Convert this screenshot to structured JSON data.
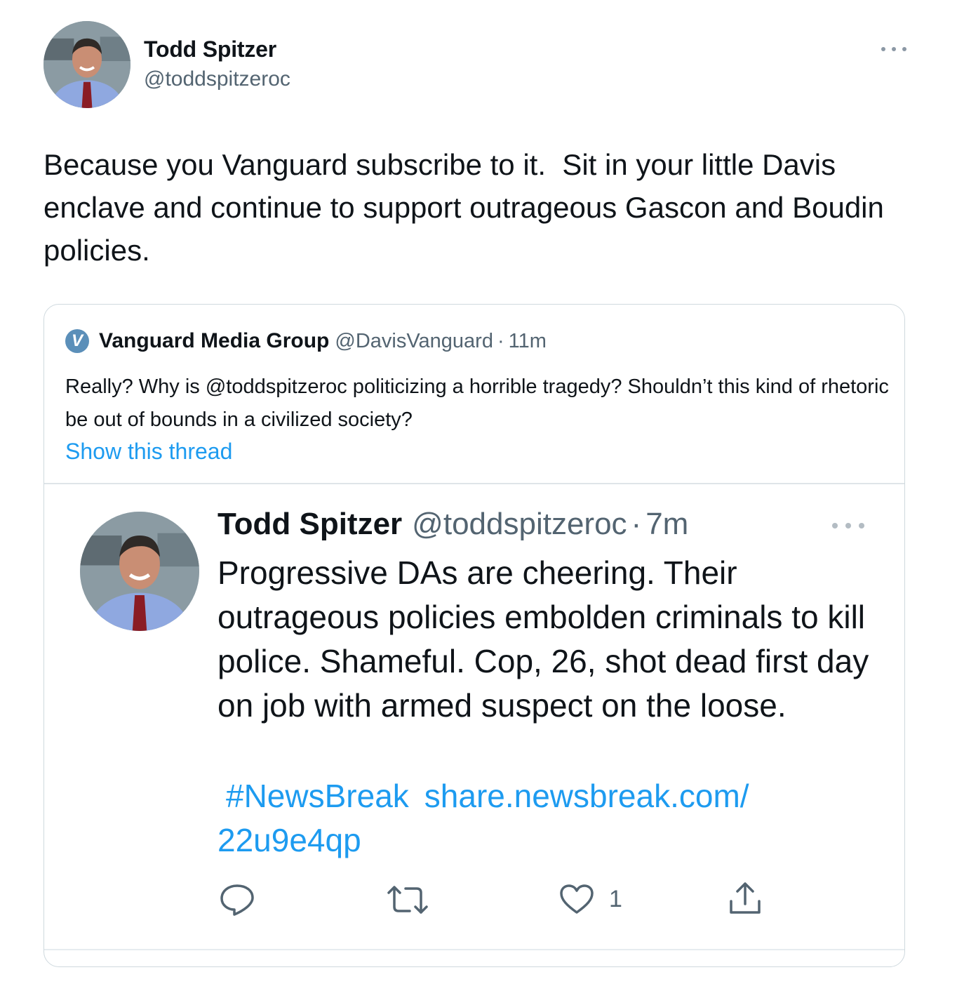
{
  "main_tweet": {
    "author_name": "Todd Spitzer",
    "author_handle": "@toddspitzeroc",
    "text": "Because you Vanguard subscribe to it.  Sit in your little Davis enclave and continue to support outrageous Gascon and Boudin policies."
  },
  "quoted_tweet": {
    "logo_letter": "V",
    "author_name": "Vanguard Media Group",
    "author_handle": "@DavisVanguard",
    "separator": "·",
    "time": "11m",
    "text": "Really?  Why is @toddspitzeroc politicizing a horrible tragedy?  Shouldn’t this kind of rhetoric be out of bounds in a civilized society?",
    "show_thread_label": "Show this thread"
  },
  "embedded_tweet": {
    "author_name": "Todd Spitzer",
    "author_handle": "@toddspitzeroc",
    "separator": "·",
    "time": "7m",
    "text": "Progressive DAs are cheering. Their outrageous policies embolden criminals to kill police. Shameful. Cop, 26, shot dead first day on job with armed suspect on the loose.",
    "hashtag": "#NewsBreak",
    "link_line1": "share.newsbreak.com/",
    "link_line2": "22u9e4qp",
    "like_count": "1",
    "icons": [
      "reply-icon",
      "retweet-icon",
      "like-icon",
      "share-icon",
      "more-icon"
    ]
  },
  "colors": {
    "link": "#1d9bf0",
    "secondary_text": "#536471",
    "border": "#cfd9de",
    "vanguard_badge": "#5b8fb9"
  }
}
